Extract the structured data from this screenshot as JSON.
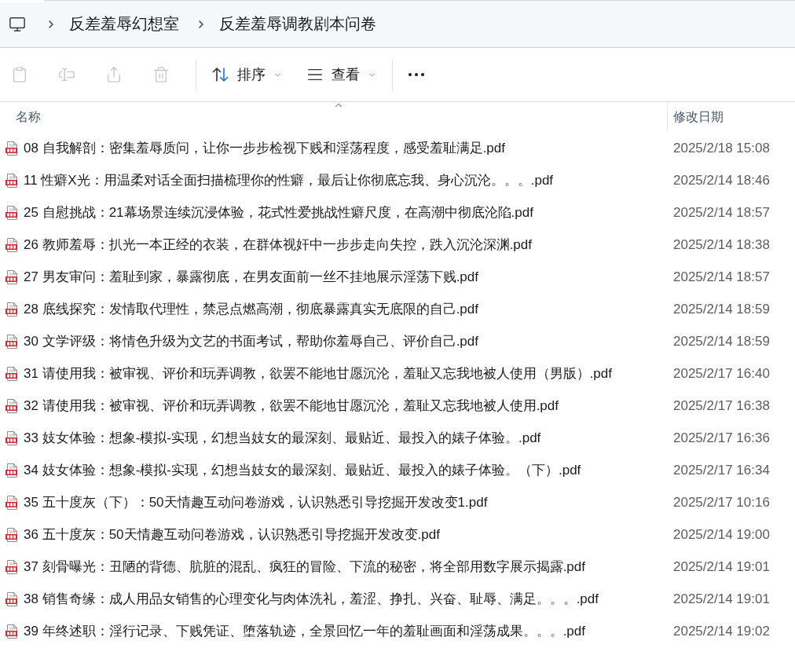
{
  "breadcrumb": [
    "反差羞辱幻想室",
    "反差羞辱调教剧本问卷"
  ],
  "toolbar": {
    "actions": [
      {
        "kind": "paste",
        "disabled": true
      },
      {
        "kind": "rename",
        "disabled": true
      },
      {
        "kind": "share",
        "disabled": true
      },
      {
        "kind": "delete",
        "disabled": true
      }
    ],
    "sort": {
      "label": "排序"
    },
    "view": {
      "label": "查看"
    }
  },
  "columns": [
    {
      "label": "名称",
      "sorted": true
    },
    {
      "label": "修改日期",
      "sorted": false
    }
  ],
  "files": [
    {
      "name": "08 自我解剖：密集羞辱质问，让你一步步检视下贱和淫荡程度，感受羞耻满足.pdf",
      "modified": "2025/2/18 15:08"
    },
    {
      "name": "11 性癖X光：用温柔对话全面扫描梳理你的性癖，最后让你彻底忘我、身心沉沦。。。.pdf",
      "modified": "2025/2/14 18:46"
    },
    {
      "name": "25 自慰挑战：21幕场景连续沉浸体验，花式性爱挑战性癖尺度，在高潮中彻底沦陷.pdf",
      "modified": "2025/2/14 18:57"
    },
    {
      "name": "26 教师羞辱：扒光一本正经的衣装，在群体视奸中一步步走向失控，跌入沉沦深渊.pdf",
      "modified": "2025/2/14 18:38"
    },
    {
      "name": "27 男友审问：羞耻到家，暴露彻底，在男友面前一丝不挂地展示淫荡下贱.pdf",
      "modified": "2025/2/14 18:57"
    },
    {
      "name": "28 底线探究：发情取代理性，禁忌点燃高潮，彻底暴露真实无底限的自己.pdf",
      "modified": "2025/2/14 18:59"
    },
    {
      "name": "30 文学评级：将情色升级为文艺的书面考试，帮助你羞辱自己、评价自己.pdf",
      "modified": "2025/2/14 18:59"
    },
    {
      "name": "31 请使用我：被审视、评价和玩弄调教，欲罢不能地甘愿沉沦，羞耻又忘我地被人使用（男版）.pdf",
      "modified": "2025/2/17 16:40"
    },
    {
      "name": "32 请使用我：被审视、评价和玩弄调教，欲罢不能地甘愿沉沦，羞耻又忘我地被人使用.pdf",
      "modified": "2025/2/17 16:38"
    },
    {
      "name": "33 妓女体验：想象-模拟-实现，幻想当妓女的最深刻、最贴近、最投入的婊子体验。.pdf",
      "modified": "2025/2/17 16:36"
    },
    {
      "name": "34 妓女体验：想象-模拟-实现，幻想当妓女的最深刻、最贴近、最投入的婊子体验。（下）.pdf",
      "modified": "2025/2/17 16:34"
    },
    {
      "name": "35 五十度灰（下）：50天情趣互动问卷游戏，认识熟悉引导挖掘开发改变1.pdf",
      "modified": "2025/2/17 10:16"
    },
    {
      "name": "36 五十度灰：50天情趣互动问卷游戏，认识熟悉引导挖掘开发改变.pdf",
      "modified": "2025/2/14 19:00"
    },
    {
      "name": "37 刻骨曝光：丑陋的背德、肮脏的混乱、疯狂的冒险、下流的秘密，将全部用数字展示揭露.pdf",
      "modified": "2025/2/14 19:01"
    },
    {
      "name": "38 销售奇缘：成人用品女销售的心理变化与肉体洗礼，羞涩、挣扎、兴奋、耻辱、满足。。。.pdf",
      "modified": "2025/2/14 19:01"
    },
    {
      "name": "39 年终述职：淫行记录、下贱凭证、堕落轨迹，全景回忆一年的羞耻画面和淫荡成果。。。.pdf",
      "modified": "2025/2/14 19:02"
    }
  ]
}
